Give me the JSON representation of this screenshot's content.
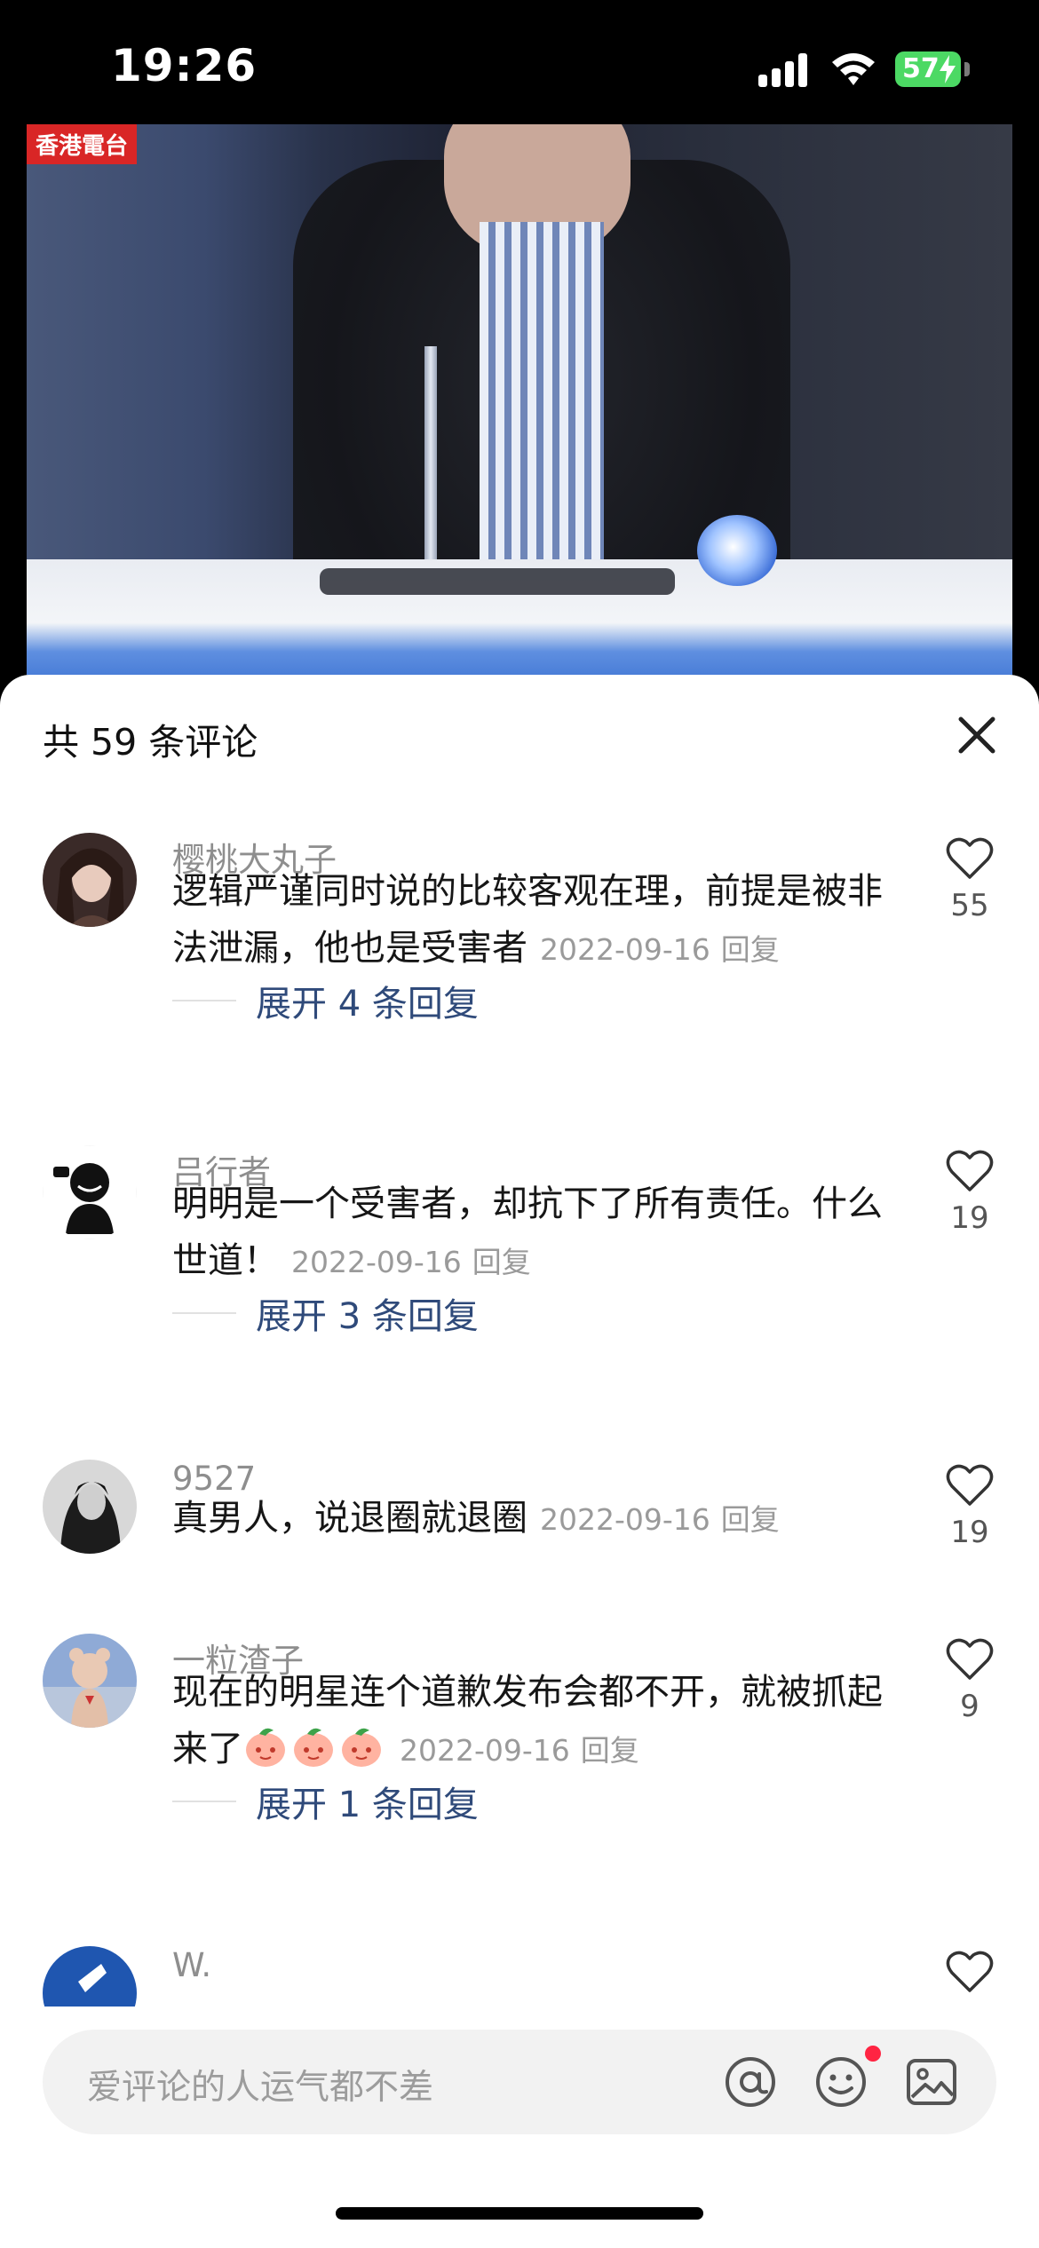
{
  "status_bar": {
    "time": "19:26",
    "battery": "57"
  },
  "video": {
    "channel_label": "香港電台"
  },
  "comments_header": {
    "title": "共 59 条评论"
  },
  "comments": [
    {
      "user": "樱桃大丸子",
      "text": "逻辑严谨同时说的比较客观在理，前提是被非法泄漏，他也是受害者",
      "date": "2022-09-16",
      "reply": "回复",
      "likes": "55",
      "expand": "展开 4 条回复"
    },
    {
      "user": "吕行者",
      "text": "明明是一个受害者，却抗下了所有责任。什么世道！",
      "date": "2022-09-16",
      "reply": "回复",
      "likes": "19",
      "expand": "展开 3 条回复"
    },
    {
      "user": "9527",
      "text": "真男人，说退圈就退圈",
      "date": "2022-09-16",
      "reply": "回复",
      "likes": "19"
    },
    {
      "user": "一粒渣子",
      "text": "现在的明星连个道歉发布会都不开，就被抓起来了",
      "date": "2022-09-16",
      "reply": "回复",
      "likes": "9",
      "expand": "展开 1 条回复"
    },
    {
      "user": "W."
    }
  ],
  "input": {
    "placeholder": "爱评论的人运气都不差",
    "icons": [
      "at-icon",
      "smile-icon",
      "image-icon"
    ]
  },
  "colors": {
    "accent_link": "#2f4a7a",
    "notification_dot": "#ff2442",
    "battery": "#4cd964"
  }
}
